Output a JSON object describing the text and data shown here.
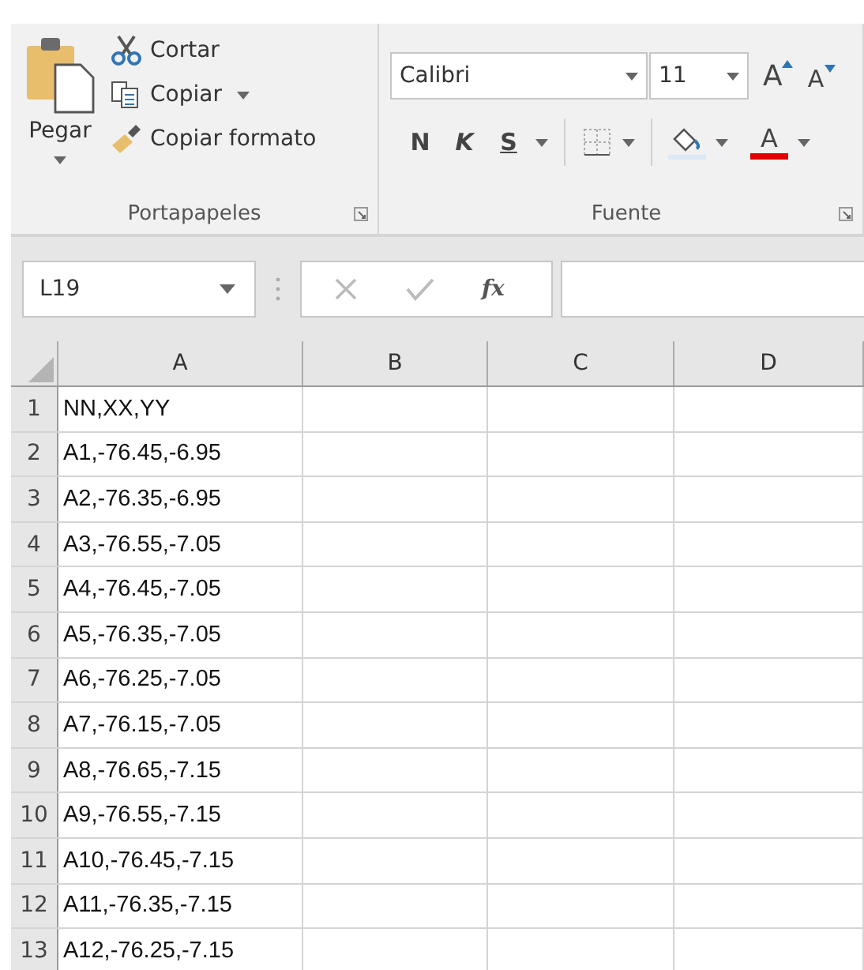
{
  "clipboard": {
    "paste_label": "Pegar",
    "items": [
      {
        "kind": "cut",
        "label": "Cortar",
        "dropdown": false
      },
      {
        "kind": "copy",
        "label": "Copiar",
        "dropdown": true
      },
      {
        "kind": "format",
        "label": "Copiar formato",
        "dropdown": false
      }
    ],
    "group_label": "Portapapeles"
  },
  "font": {
    "name": "Calibri",
    "size": "11",
    "size_buttons": [
      {
        "kind": "grow",
        "label": "A"
      },
      {
        "kind": "shrink",
        "label": "A"
      }
    ],
    "style_buttons": [
      {
        "kind": "bold",
        "label": "N"
      },
      {
        "kind": "italic",
        "label": "K"
      },
      {
        "kind": "underline",
        "label": "S"
      }
    ],
    "color_label": "A",
    "group_label": "Fuente"
  },
  "formula_bar": {
    "name_box": "L19",
    "fx": "fx"
  },
  "sheet": {
    "columns": [
      "A",
      "B",
      "C",
      "D"
    ],
    "rows": [
      {
        "number": "1",
        "cells": [
          "NN,XX,YY"
        ]
      },
      {
        "number": "2",
        "cells": [
          "A1,-76.45,-6.95"
        ]
      },
      {
        "number": "3",
        "cells": [
          "A2,-76.35,-6.95"
        ]
      },
      {
        "number": "4",
        "cells": [
          "A3,-76.55,-7.05"
        ]
      },
      {
        "number": "5",
        "cells": [
          "A4,-76.45,-7.05"
        ]
      },
      {
        "number": "6",
        "cells": [
          "A5,-76.35,-7.05"
        ]
      },
      {
        "number": "7",
        "cells": [
          "A6,-76.25,-7.05"
        ]
      },
      {
        "number": "8",
        "cells": [
          "A7,-76.15,-7.05"
        ]
      },
      {
        "number": "9",
        "cells": [
          "A8,-76.65,-7.15"
        ]
      },
      {
        "number": "10",
        "cells": [
          "A9,-76.55,-7.15"
        ]
      },
      {
        "number": "11",
        "cells": [
          "A10,-76.45,-7.15"
        ]
      },
      {
        "number": "12",
        "cells": [
          "A11,-76.35,-7.15"
        ]
      },
      {
        "number": "13",
        "cells": [
          "A12,-76.25,-7.15"
        ]
      }
    ]
  }
}
